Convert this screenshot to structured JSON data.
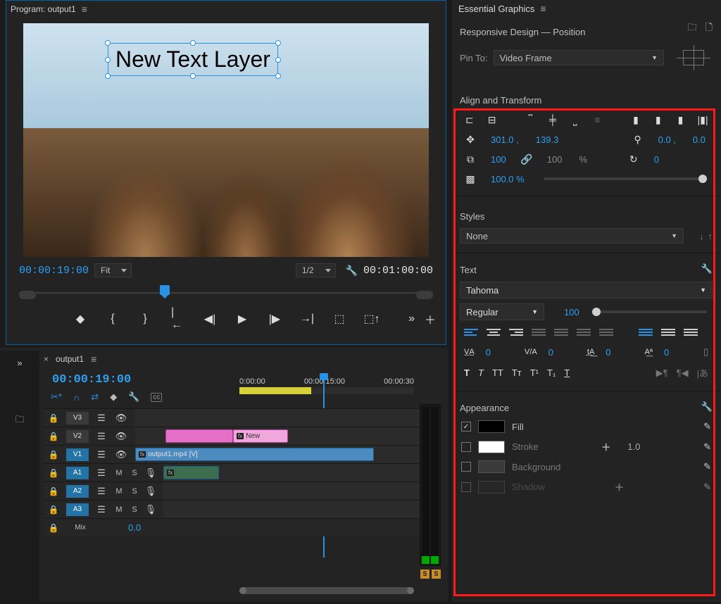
{
  "program": {
    "title": "Program: output1",
    "text_layer": "New Text Layer",
    "timecode_current": "00:00:19:00",
    "timecode_total": "00:01:00:00",
    "zoom_mode": "Fit",
    "resolution": "1/2"
  },
  "timeline": {
    "tab": "output1",
    "timecode": "00:00:19:00",
    "ruler": [
      "0:00:00",
      "00:00:15:00",
      "00:00:30"
    ],
    "tracks": {
      "v3": "V3",
      "v2": "V2",
      "v1": "V1",
      "a1": "A1",
      "a2": "A2",
      "a3": "A3",
      "mix": "Mix",
      "mix_val": "0.0"
    },
    "clips": {
      "video": "output1.mp4 [V]",
      "new_text": "New"
    },
    "solo": "S"
  },
  "eg": {
    "title": "Essential Graphics",
    "responsive": "Responsive Design — Position",
    "pin_to_label": "Pin To:",
    "pin_to_value": "Video Frame",
    "align_title": "Align and Transform",
    "pos_x": "301.0 ,",
    "pos_y": "139.3",
    "anc_x": "0.0 ,",
    "anc_y": "0.0",
    "scale": "100",
    "scale_link": "100",
    "pct": "%",
    "rotation": "0",
    "opacity": "100.0 %",
    "styles_title": "Styles",
    "style_value": "None",
    "text_title": "Text",
    "font": "Tahoma",
    "font_style": "Regular",
    "font_size": "100",
    "tracking": "0",
    "kerning": "0",
    "baseline": "0",
    "leading": "0",
    "bold": "T",
    "italic": "T",
    "allcaps": "TT",
    "smallcaps": "Tᴛ",
    "super": "T¹",
    "sub": "T₁",
    "under": "T",
    "appearance_title": "Appearance",
    "fill": "Fill",
    "stroke": "Stroke",
    "stroke_val": "1.0",
    "background": "Background",
    "shadow": "Shadow"
  }
}
